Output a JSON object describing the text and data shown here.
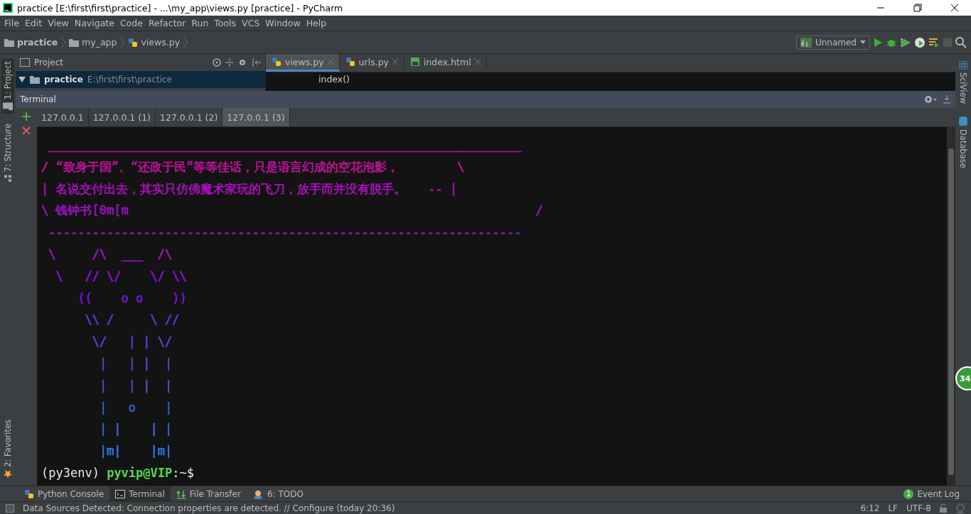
{
  "window": {
    "title": "practice [E:\\first\\first\\practice] - ...\\my_app\\views.py [practice] - PyCharm"
  },
  "menu": [
    "File",
    "Edit",
    "View",
    "Navigate",
    "Code",
    "Refactor",
    "Run",
    "Tools",
    "VCS",
    "Window",
    "Help"
  ],
  "breadcrumbs": [
    {
      "label": "practice",
      "kind": "folder"
    },
    {
      "label": "my_app",
      "kind": "package"
    },
    {
      "label": "views.py",
      "kind": "python"
    }
  ],
  "run_config": {
    "label": "Unnamed"
  },
  "left_strip": [
    {
      "label": "1: Project",
      "selected": true,
      "kind": "project"
    },
    {
      "label": "7: Structure",
      "selected": false,
      "kind": "structure"
    },
    {
      "label": "2: Favorites",
      "selected": false,
      "kind": "favorites"
    }
  ],
  "right_strip": [
    {
      "label": "SciView",
      "kind": "grid"
    },
    {
      "label": "Database",
      "kind": "db"
    }
  ],
  "project_panel": {
    "title": "Project",
    "root": {
      "name": "practice",
      "path": "E:\\first\\first\\practice",
      "expanded": true,
      "selected": true
    }
  },
  "editor": {
    "tabs": [
      {
        "label": "views.py",
        "selected": true,
        "kind": "python"
      },
      {
        "label": "urls.py",
        "selected": false,
        "kind": "python"
      },
      {
        "label": "index.html",
        "selected": false,
        "kind": "html"
      }
    ],
    "lines": [
      "index()"
    ]
  },
  "terminal": {
    "title": "Terminal",
    "tabs": [
      {
        "label": "127.0.0.1",
        "selected": false
      },
      {
        "label": "127.0.0.1 (1)",
        "selected": false
      },
      {
        "label": "127.0.0.1 (2)",
        "selected": false
      },
      {
        "label": "127.0.0.1 (3)",
        "selected": true
      }
    ],
    "lines": [
      {
        "text": " _________________________________________________________________",
        "color": "#b8149f"
      },
      {
        "text": "/ “致身于国”、“还政于民”等等佳话，只是语言幻成的空花泡影，        \\",
        "color": "#c0129c"
      },
      {
        "text": "| 名说交付出去，其实只仿佛魔术家玩的飞刀，放手而并没有脱手。   -- |",
        "color": "#a810b8"
      },
      {
        "text": "\\ 钱钟书[0m[m                                                        /",
        "color": "#9a14c0"
      },
      {
        "text": " -----------------------------------------------------------------",
        "color": "#8a1cc8"
      },
      {
        "text": " \\     /\\  ___  /\\",
        "color": "#a010c8"
      },
      {
        "text": "  \\   // \\/    \\/ \\\\",
        "color": "#8a10d8"
      },
      {
        "text": "     ((    o o    ))",
        "color": "#7a12e0"
      },
      {
        "text": "      \\\\ /     \\ //",
        "color": "#6a30d8"
      },
      {
        "text": "       \\/   | | \\/",
        "color": "#5c3cd4"
      },
      {
        "text": "        |   | |  |",
        "color": "#5048cc"
      },
      {
        "text": "        |   | |  |",
        "color": "#4850c8"
      },
      {
        "text": "        |   o    |",
        "color": "#4058c8"
      },
      {
        "text": "        | |    | |",
        "color": "#3a62d0"
      },
      {
        "text": "        |m|    |m|",
        "color": "#2a78e0"
      }
    ],
    "prompt": {
      "env": "(py3env)",
      "user_host": "pyvip@VIP",
      "path": ":~$"
    }
  },
  "notification_badge": "34",
  "tool_windows": [
    {
      "label": "Python Console",
      "selected": false,
      "kind": "python"
    },
    {
      "label": "Terminal",
      "selected": true,
      "kind": "terminal"
    },
    {
      "label": "File Transfer",
      "selected": false,
      "kind": "transfer"
    },
    {
      "label": "6: TODO",
      "selected": false,
      "kind": "todo"
    }
  ],
  "event_log": {
    "label": "Event Log",
    "count": "1"
  },
  "status": {
    "message": "Data Sources Detected: Connection properties are detected. // Configure (today 20:36)",
    "position": "6:12",
    "line_separator": "LF",
    "encoding": "UTF-8"
  }
}
